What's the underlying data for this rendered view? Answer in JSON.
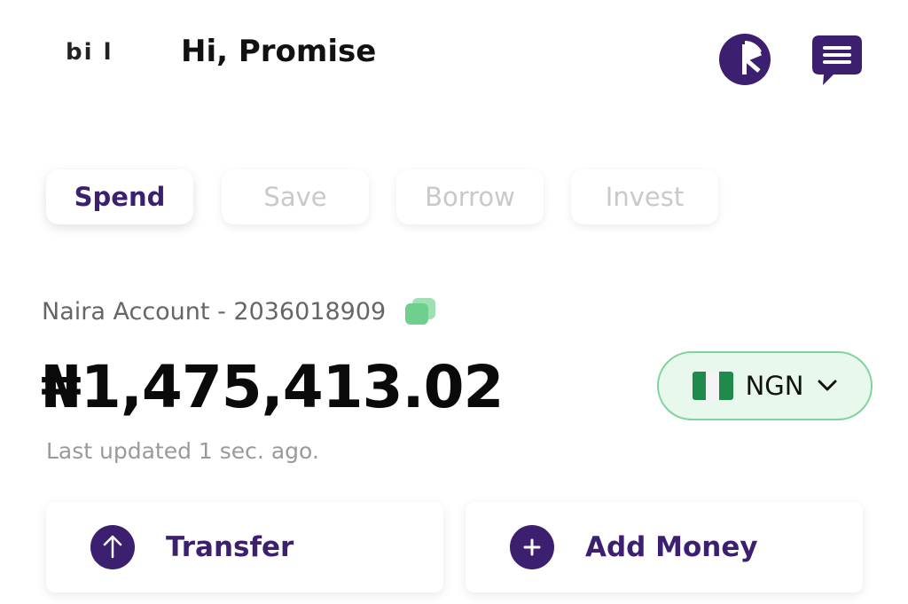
{
  "header": {
    "logo_text": "bi l",
    "greeting": "Hi, Promise",
    "analytics_icon": "pie-chart-icon",
    "chat_icon": "chat-icon"
  },
  "tabs": [
    {
      "label": "Spend",
      "active": true
    },
    {
      "label": "Save",
      "active": false
    },
    {
      "label": "Borrow",
      "active": false
    },
    {
      "label": "Invest",
      "active": false
    }
  ],
  "account": {
    "label": "Naira Account - 2036018909",
    "copy_icon": "copy-icon",
    "balance": "₦1,475,413.02",
    "last_updated": "Last updated 1 sec. ago."
  },
  "currency": {
    "code": "NGN",
    "flag": "nigeria-flag-icon"
  },
  "actions": [
    {
      "label": "Transfer",
      "icon": "arrow-up-icon"
    },
    {
      "label": "Add Money",
      "icon": "plus-icon"
    }
  ],
  "colors": {
    "brand_purple": "#3d1f70",
    "accent_green": "#7fd49b",
    "pill_bg": "#e8f8ec"
  }
}
